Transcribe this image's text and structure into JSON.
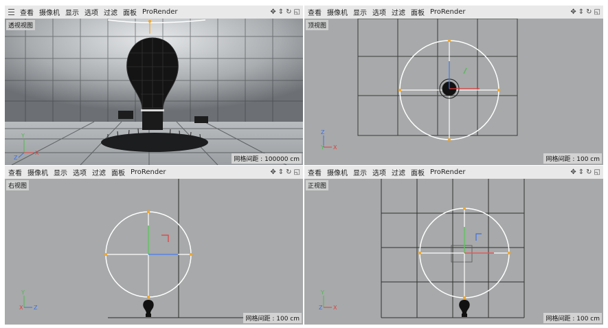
{
  "menu": [
    "查看",
    "摄像机",
    "显示",
    "选项",
    "过滤",
    "面板",
    "ProRender"
  ],
  "nav_icons": [
    "move-icon",
    "zoom-icon",
    "rotate-icon",
    "maximize-icon"
  ],
  "axis_labels": {
    "x": "X",
    "y": "Y",
    "z": "Z"
  },
  "viewports": {
    "perspective": {
      "label": "透视视图",
      "grid_spacing": "网格间距 : 100000 cm"
    },
    "top": {
      "label": "顶视图",
      "grid_spacing": "网格间距 : 100 cm"
    },
    "right": {
      "label": "右视图",
      "grid_spacing": "网格间距 : 100 cm"
    },
    "front": {
      "label": "正视图",
      "grid_spacing": "网格间距 : 100 cm"
    }
  },
  "colors": {
    "viewport_bg": "#a7a9aa",
    "light_circle": "#ffffff",
    "handle": "#f5a623",
    "axis_x": "#e63b3b",
    "axis_y": "#4cbb4c",
    "axis_z": "#3b6fe6"
  }
}
